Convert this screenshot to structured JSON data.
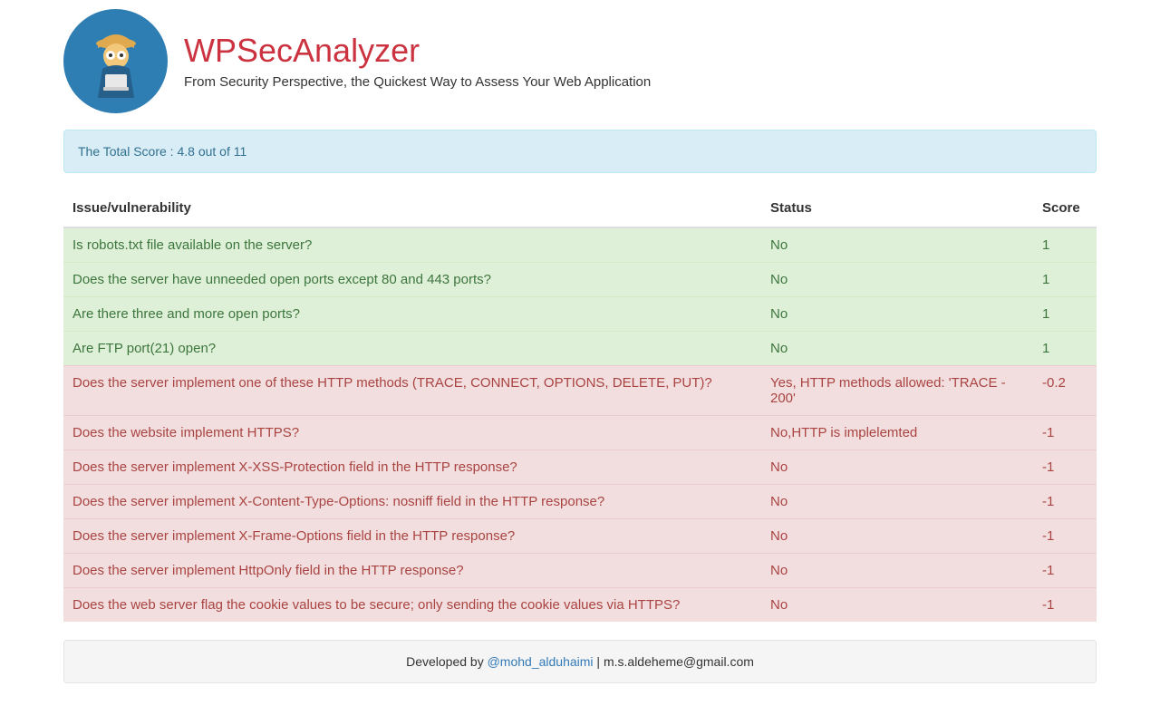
{
  "header": {
    "title": "WPSecAnalyzer",
    "tagline": "From Security Perspective, the Quickest Way to Assess Your Web Application"
  },
  "score_panel": "The Total Score : 4.8 out of 11",
  "columns": {
    "issue": "Issue/vulnerability",
    "status": "Status",
    "score": "Score"
  },
  "rows": [
    {
      "type": "pass",
      "issue": "Is robots.txt file available on the server?",
      "status": "No",
      "score": "1"
    },
    {
      "type": "pass",
      "issue": "Does the server have unneeded open ports except 80 and 443 ports?",
      "status": "No",
      "score": "1"
    },
    {
      "type": "pass",
      "issue": "Are there three and more open ports?",
      "status": "No",
      "score": "1"
    },
    {
      "type": "pass",
      "issue": "Are FTP port(21) open?",
      "status": "No",
      "score": "1"
    },
    {
      "type": "fail",
      "issue": "Does the server implement one of these HTTP methods (TRACE, CONNECT, OPTIONS, DELETE, PUT)?",
      "status": "Yes, HTTP methods allowed: 'TRACE - 200'",
      "score": "-0.2"
    },
    {
      "type": "fail",
      "issue": "Does the website implement HTTPS?",
      "status": "No,HTTP is implelemted",
      "score": "-1"
    },
    {
      "type": "fail",
      "issue": "Does the server implement X-XSS-Protection field in the HTTP response?",
      "status": "No",
      "score": "-1"
    },
    {
      "type": "fail",
      "issue": "Does the server implement X-Content-Type-Options: nosniff field in the HTTP response?",
      "status": "No",
      "score": "-1"
    },
    {
      "type": "fail",
      "issue": "Does the server implement X-Frame-Options field in the HTTP response?",
      "status": "No",
      "score": "-1"
    },
    {
      "type": "fail",
      "issue": "Does the server implement HttpOnly field in the HTTP response?",
      "status": "No",
      "score": "-1"
    },
    {
      "type": "fail",
      "issue": "Does the web server flag the cookie values to be secure; only sending the cookie values via HTTPS?",
      "status": "No",
      "score": "-1"
    }
  ],
  "footer": {
    "prefix": "Developed by ",
    "link_text": "@mohd_alduhaimi",
    "suffix": " | m.s.aldeheme@gmail.com"
  }
}
